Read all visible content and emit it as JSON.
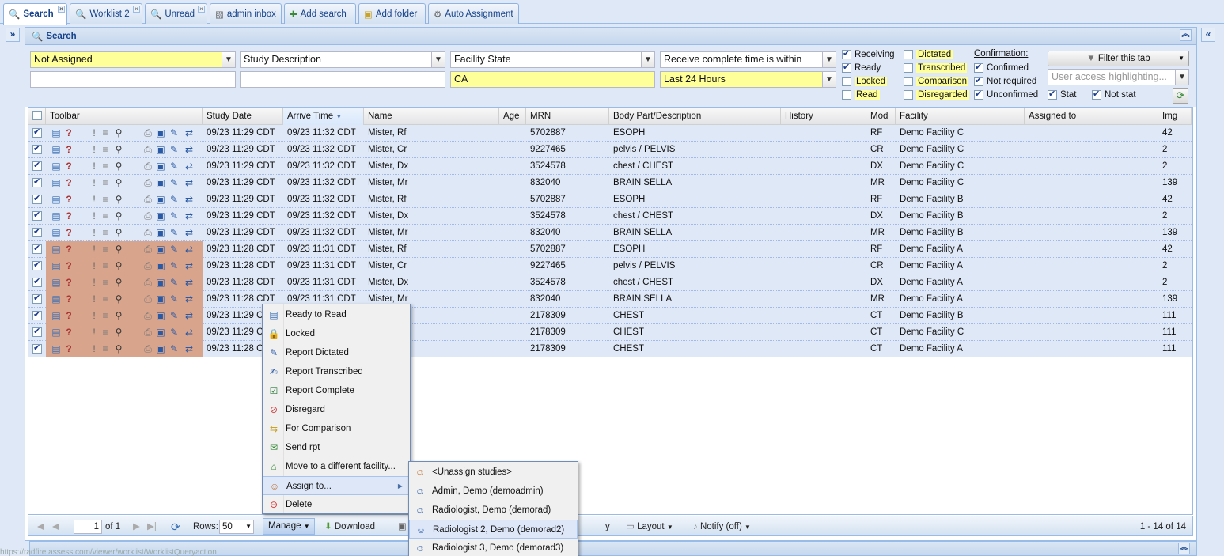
{
  "tabs": [
    {
      "label": "Search",
      "icon": "magnifier-icon",
      "closable": true,
      "active": true
    },
    {
      "label": "Worklist 2",
      "icon": "magnifier-icon",
      "closable": true
    },
    {
      "label": "Unread",
      "icon": "magnifier-icon",
      "closable": true
    },
    {
      "label": "admin inbox",
      "icon": "inbox-icon"
    },
    {
      "label": "Add search",
      "icon": "add-search-icon"
    },
    {
      "label": "Add folder",
      "icon": "add-folder-icon"
    },
    {
      "label": "Auto Assignment",
      "icon": "gear-icon"
    }
  ],
  "panel": {
    "title": "Search"
  },
  "filters": {
    "sel1": "Not Assigned",
    "sel2": "Study Description",
    "sel3": "Facility State",
    "sel4": "Receive complete time is within",
    "in1": "",
    "in2": "",
    "in3": "CA",
    "in4": "Last 24 Hours",
    "status_col1": [
      {
        "label": "Receiving",
        "checked": true
      },
      {
        "label": "Ready",
        "checked": true
      },
      {
        "label": "Locked",
        "checked": false
      },
      {
        "label": "Read",
        "checked": false
      }
    ],
    "status_col2": [
      {
        "label": "Dictated",
        "checked": false
      },
      {
        "label": "Transcribed",
        "checked": false
      },
      {
        "label": "Comparison",
        "checked": false
      },
      {
        "label": "Disregarded",
        "checked": false
      }
    ],
    "confirmation_title": "Confirmation:",
    "confirmation": [
      {
        "label": "Confirmed",
        "checked": true
      },
      {
        "label": "Not required",
        "checked": true
      },
      {
        "label": "Unconfirmed",
        "checked": true
      }
    ],
    "stat": {
      "label": "Stat",
      "checked": true
    },
    "not_stat": {
      "label": "Not stat",
      "checked": true
    },
    "filter_tab_button": "Filter this tab",
    "highlight_placeholder": "User access highlighting..."
  },
  "grid": {
    "columns": [
      "Toolbar",
      "Study Date",
      "Arrive Time",
      "Name",
      "Age",
      "MRN",
      "Body Part/Description",
      "History",
      "Mod",
      "Facility",
      "Assigned to",
      "Img"
    ],
    "rows": [
      {
        "study_date": "09/23 11:29 CDT",
        "arrive": "09/23 11:32 CDT",
        "name": "Mister, Rf",
        "mrn": "5702887",
        "body": "ESOPH",
        "mod": "RF",
        "facility": "Demo Facility C",
        "img": "42",
        "orange": false
      },
      {
        "study_date": "09/23 11:29 CDT",
        "arrive": "09/23 11:32 CDT",
        "name": "Mister, Cr",
        "mrn": "9227465",
        "body": "pelvis / PELVIS",
        "mod": "CR",
        "facility": "Demo Facility C",
        "img": "2",
        "orange": false
      },
      {
        "study_date": "09/23 11:29 CDT",
        "arrive": "09/23 11:32 CDT",
        "name": "Mister, Dx",
        "mrn": "3524578",
        "body": "chest / CHEST",
        "mod": "DX",
        "facility": "Demo Facility C",
        "img": "2",
        "orange": false
      },
      {
        "study_date": "09/23 11:29 CDT",
        "arrive": "09/23 11:32 CDT",
        "name": "Mister, Mr",
        "mrn": "832040",
        "body": "BRAIN SELLA",
        "mod": "MR",
        "facility": "Demo Facility C",
        "img": "139",
        "orange": false
      },
      {
        "study_date": "09/23 11:29 CDT",
        "arrive": "09/23 11:32 CDT",
        "name": "Mister, Rf",
        "mrn": "5702887",
        "body": "ESOPH",
        "mod": "RF",
        "facility": "Demo Facility B",
        "img": "42",
        "orange": false
      },
      {
        "study_date": "09/23 11:29 CDT",
        "arrive": "09/23 11:32 CDT",
        "name": "Mister, Dx",
        "mrn": "3524578",
        "body": "chest / CHEST",
        "mod": "DX",
        "facility": "Demo Facility B",
        "img": "2",
        "orange": false
      },
      {
        "study_date": "09/23 11:29 CDT",
        "arrive": "09/23 11:32 CDT",
        "name": "Mister, Mr",
        "mrn": "832040",
        "body": "BRAIN SELLA",
        "mod": "MR",
        "facility": "Demo Facility B",
        "img": "139",
        "orange": false
      },
      {
        "study_date": "09/23 11:28 CDT",
        "arrive": "09/23 11:31 CDT",
        "name": "Mister, Rf",
        "mrn": "5702887",
        "body": "ESOPH",
        "mod": "RF",
        "facility": "Demo Facility A",
        "img": "42",
        "orange": true
      },
      {
        "study_date": "09/23 11:28 CDT",
        "arrive": "09/23 11:31 CDT",
        "name": "Mister, Cr",
        "mrn": "9227465",
        "body": "pelvis / PELVIS",
        "mod": "CR",
        "facility": "Demo Facility A",
        "img": "2",
        "orange": true
      },
      {
        "study_date": "09/23 11:28 CDT",
        "arrive": "09/23 11:31 CDT",
        "name": "Mister, Dx",
        "mrn": "3524578",
        "body": "chest / CHEST",
        "mod": "DX",
        "facility": "Demo Facility A",
        "img": "2",
        "orange": true
      },
      {
        "study_date": "09/23 11:28 CDT",
        "arrive": "09/23 11:31 CDT",
        "name": "Mister, Mr",
        "mrn": "832040",
        "body": "BRAIN SELLA",
        "mod": "MR",
        "facility": "Demo Facility A",
        "img": "139",
        "orange": true
      },
      {
        "study_date": "09/23 11:29 C",
        "arrive": "",
        "name": "",
        "mrn": "2178309",
        "body": "CHEST",
        "mod": "CT",
        "facility": "Demo Facility B",
        "img": "111",
        "orange": true
      },
      {
        "study_date": "09/23 11:29 C",
        "arrive": "",
        "name": "",
        "mrn": "2178309",
        "body": "CHEST",
        "mod": "CT",
        "facility": "Demo Facility C",
        "img": "111",
        "orange": true
      },
      {
        "study_date": "09/23 11:28 C",
        "arrive": "",
        "name": "",
        "mrn": "2178309",
        "body": "CHEST",
        "mod": "CT",
        "facility": "Demo Facility A",
        "img": "111",
        "orange": true
      }
    ]
  },
  "toolbar": {
    "page_value": "1",
    "of_pages": "of 1",
    "rows_label": "Rows:",
    "rows_value": "50",
    "manage": "Manage",
    "download": "Download",
    "partial_y": "y",
    "layout": "Layout",
    "notify": "Notify (off)",
    "count": "1 - 14 of 14"
  },
  "manage_menu": [
    {
      "label": "Ready to Read",
      "icon": "ready-to-read-icon"
    },
    {
      "label": "Locked",
      "icon": "lock-icon"
    },
    {
      "label": "Report Dictated",
      "icon": "report-dictated-icon"
    },
    {
      "label": "Report Transcribed",
      "icon": "report-transcribed-icon"
    },
    {
      "label": "Report Complete",
      "icon": "report-complete-icon"
    },
    {
      "label": "Disregard",
      "icon": "disregard-icon"
    },
    {
      "label": "For Comparison",
      "icon": "comparison-icon"
    },
    {
      "label": "Send rpt",
      "icon": "send-report-icon"
    },
    {
      "label": "Move to a different facility...",
      "icon": "move-facility-icon"
    },
    {
      "label": "Assign to...",
      "icon": "assign-user-icon",
      "submenu": true
    },
    {
      "label": "Delete",
      "icon": "delete-icon"
    }
  ],
  "assign_menu": [
    {
      "label": "<Unassign studies>",
      "icon": "unassign-user-icon"
    },
    {
      "label": "Admin, Demo (demoadmin)",
      "icon": "user-icon"
    },
    {
      "label": "Radiologist, Demo (demorad)",
      "icon": "user-icon"
    },
    {
      "label": "Radiologist 2, Demo (demorad2)",
      "icon": "user-icon"
    },
    {
      "label": "Radiologist 3, Demo (demorad3)",
      "icon": "user-icon"
    }
  ],
  "status_url": "https://radfire.assess.com/viewer/worklist/WorklistQueryaction"
}
